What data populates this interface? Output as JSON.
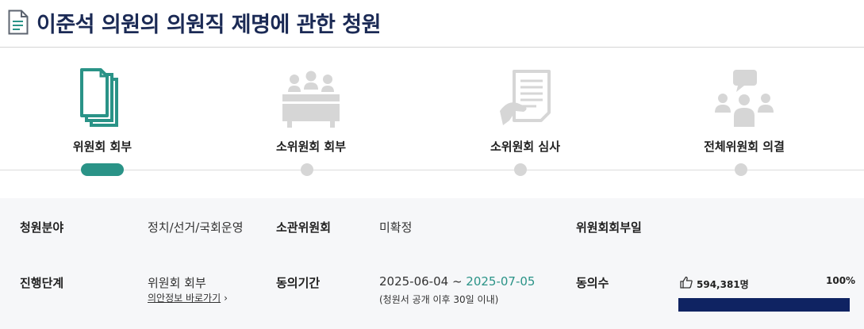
{
  "page": {
    "title": "이준석 의원의 의원직 제명에 관한 청원",
    "icon": "document-icon"
  },
  "colors": {
    "title": "#1b2a55",
    "accent": "#2a9387",
    "inactive": "#d6d6d6",
    "progress": "#0f2362"
  },
  "steps": [
    {
      "label": "위원회 회부",
      "icon": "documents-stack-icon",
      "active": true
    },
    {
      "label": "소위원회 회부",
      "icon": "meeting-table-icon",
      "active": false
    },
    {
      "label": "소위원회 심사",
      "icon": "review-document-icon",
      "active": false
    },
    {
      "label": "전체위원회 의결",
      "icon": "discussion-group-icon",
      "active": false
    }
  ],
  "info": {
    "field_label": "청원분야",
    "field_value": "정치/선거/국회운영",
    "committee_label": "소관위원회",
    "committee_value": "미확정",
    "referral_date_label": "위원회회부일",
    "referral_date_value": "",
    "stage_label": "진행단계",
    "stage_value": "위원회 회부",
    "bill_link_label": "의안정보 바로가기",
    "period_label": "동의기간",
    "period_start": "2025-06-04 ~ ",
    "period_end": "2025-07-05",
    "period_note": "(청원서 공개 이후 30일 이내)",
    "agree_label": "동의수",
    "agree_count": "594,381명",
    "agree_percent_label": "100%",
    "agree_percent": 100
  }
}
